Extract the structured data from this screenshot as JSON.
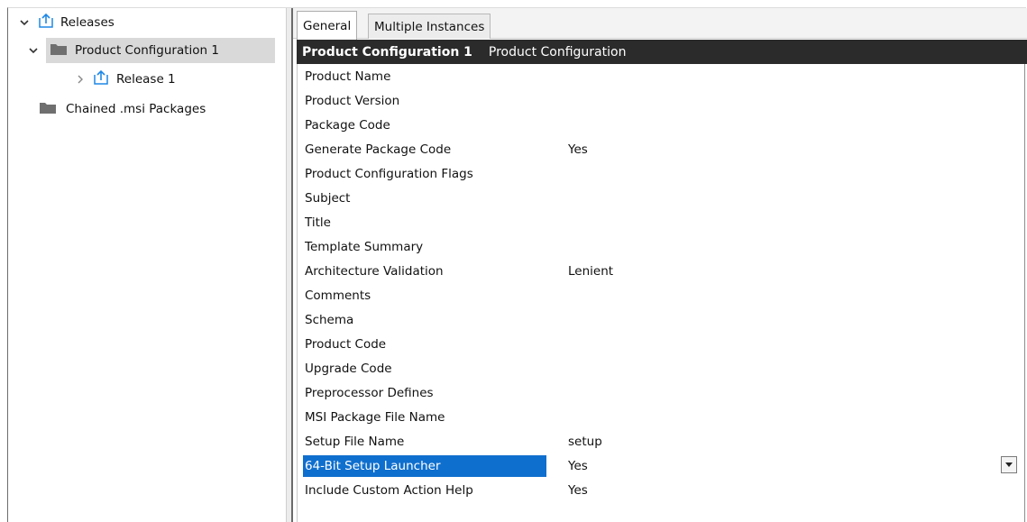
{
  "tree": {
    "items": [
      {
        "label": "Releases",
        "level": 0,
        "expanded": true,
        "icon": "release-icon"
      },
      {
        "label": "Product Configuration 1",
        "level": 1,
        "expanded": true,
        "icon": "folder-icon",
        "selected": true
      },
      {
        "label": "Release 1",
        "level": 2,
        "expanded": false,
        "icon": "release-icon"
      },
      {
        "label": "Chained .msi Packages",
        "level": 0,
        "icon": "folder-icon"
      }
    ]
  },
  "tabs": [
    {
      "label": "General",
      "active": true
    },
    {
      "label": "Multiple Instances",
      "active": false
    }
  ],
  "header": {
    "name": "Product Configuration 1",
    "type": "Product Configuration"
  },
  "properties": [
    {
      "name": "Product Name",
      "value": ""
    },
    {
      "name": "Product Version",
      "value": ""
    },
    {
      "name": "Package Code",
      "value": ""
    },
    {
      "name": "Generate Package Code",
      "value": "Yes"
    },
    {
      "name": "Product Configuration Flags",
      "value": ""
    },
    {
      "name": "Subject",
      "value": ""
    },
    {
      "name": "Title",
      "value": ""
    },
    {
      "name": "Template Summary",
      "value": ""
    },
    {
      "name": "Architecture Validation",
      "value": "Lenient"
    },
    {
      "name": "Comments",
      "value": ""
    },
    {
      "name": "Schema",
      "value": ""
    },
    {
      "name": "Product Code",
      "value": ""
    },
    {
      "name": "Upgrade Code",
      "value": ""
    },
    {
      "name": "Preprocessor Defines",
      "value": ""
    },
    {
      "name": "MSI Package File Name",
      "value": ""
    },
    {
      "name": "Setup File Name",
      "value": "setup"
    },
    {
      "name": "64-Bit Setup Launcher",
      "value": "Yes",
      "selected": true,
      "dropdown": true
    },
    {
      "name": "Include Custom Action Help",
      "value": "Yes"
    }
  ],
  "colors": {
    "selection": "#0f6fce",
    "header_bg": "#2b2b2b",
    "inactive_selection": "#d9d9d9"
  }
}
